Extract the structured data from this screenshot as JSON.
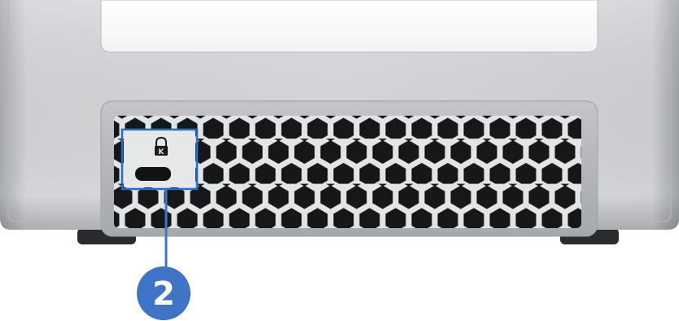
{
  "device": {
    "name": "",
    "body_color": "#c9cbce",
    "vent_color": "#1b1c1e",
    "foot_color": "#2a2b2d",
    "top_window_color": "#ffffff"
  },
  "port": {
    "icon": "kensington-lock-icon",
    "label_glyph": "🔒︎"
  },
  "callout": {
    "number": "2",
    "color": "#3f74c6",
    "highlight_color": "#1f6fd1"
  }
}
